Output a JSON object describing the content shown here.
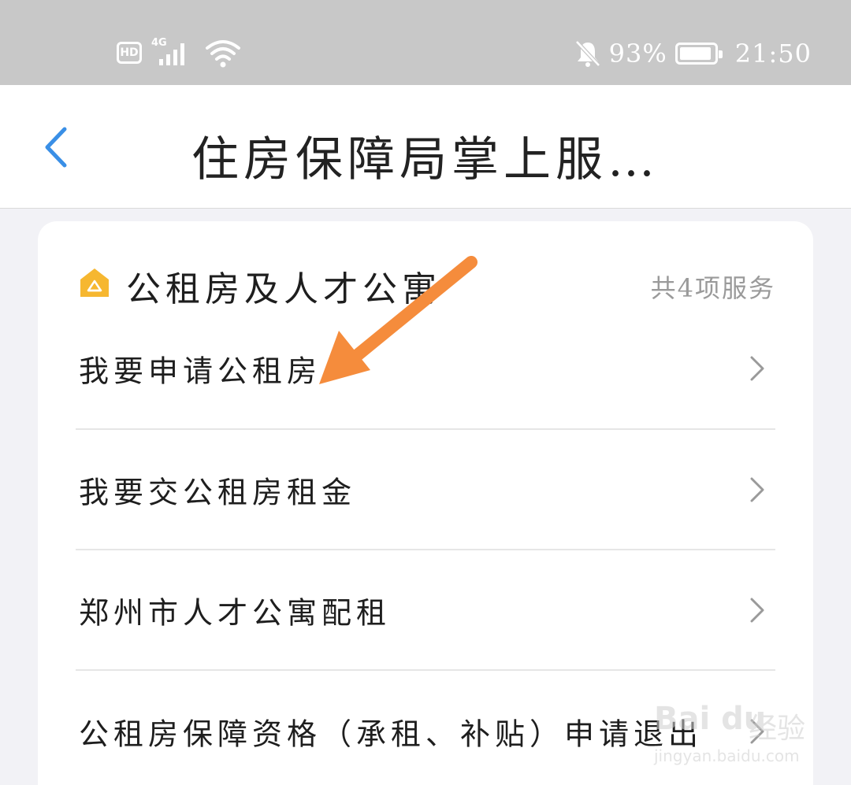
{
  "status_bar": {
    "hd_label": "HD",
    "network_label": "4G",
    "battery_text": "93%",
    "battery_level": 0.93,
    "time": "21:50",
    "icons": [
      "hd-icon",
      "signal-icon",
      "wifi-icon",
      "bell-muted-icon",
      "battery-icon"
    ]
  },
  "header": {
    "back_icon": "chevron-left-icon",
    "title": "住房保障局掌上服…"
  },
  "section": {
    "icon": "house-icon",
    "title": "公租房及人才公寓",
    "count": "共4项服务",
    "items": [
      {
        "label": "我要申请公租房"
      },
      {
        "label": "我要交公租房租金"
      },
      {
        "label": "郑州市人才公寓配租"
      },
      {
        "label": "公租房保障资格（承租、补贴）申请退出"
      }
    ]
  },
  "watermark": {
    "logo_text": "Bai du",
    "cn_text": "经验",
    "url": "jingyan.baidu.com"
  },
  "colors": {
    "status_bar_bg": "#c8c8c8",
    "accent_blue": "#3a8fe6",
    "icon_orange": "#f6b730",
    "arrow_orange": "#f58c3c",
    "page_bg": "#f2f2f6"
  }
}
